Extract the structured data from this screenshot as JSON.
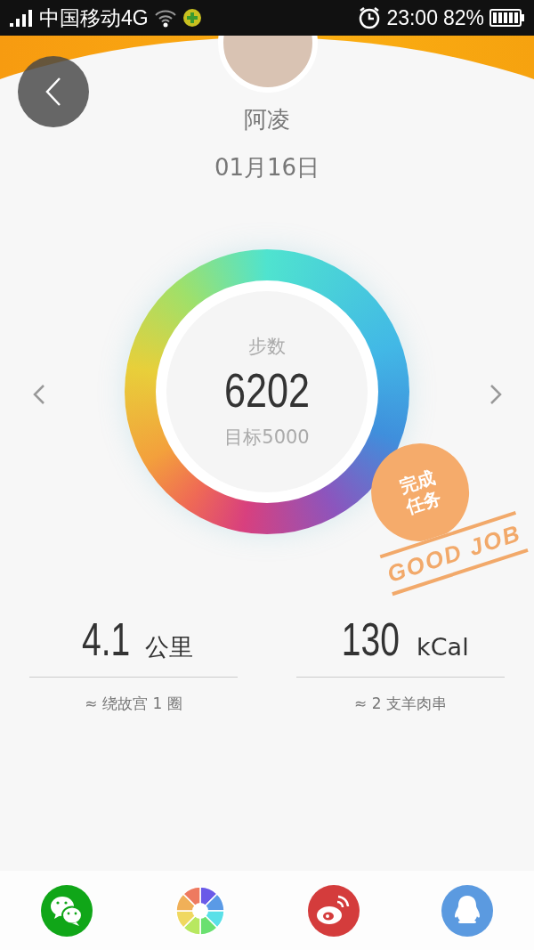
{
  "status_bar": {
    "carrier": "中国移动4G",
    "time": "23:00",
    "battery": "82%"
  },
  "profile": {
    "name": "阿凌",
    "date": "01月16日"
  },
  "steps": {
    "label": "步数",
    "value": "6202",
    "goal": "目标5000"
  },
  "badge": {
    "line_1": "完成",
    "line_2": "任务",
    "caption": "GOOD JOB"
  },
  "stats": [
    {
      "value": "4.1",
      "unit": "公里",
      "comparison": "≈ 绕故宫 1 圈"
    },
    {
      "value": "130",
      "unit": "kCal",
      "comparison": "≈ 2 支羊肉串"
    }
  ],
  "share": [
    {
      "kind": "chat"
    },
    {
      "kind": "aperture"
    },
    {
      "kind": "eye"
    },
    {
      "kind": "penguin"
    }
  ]
}
